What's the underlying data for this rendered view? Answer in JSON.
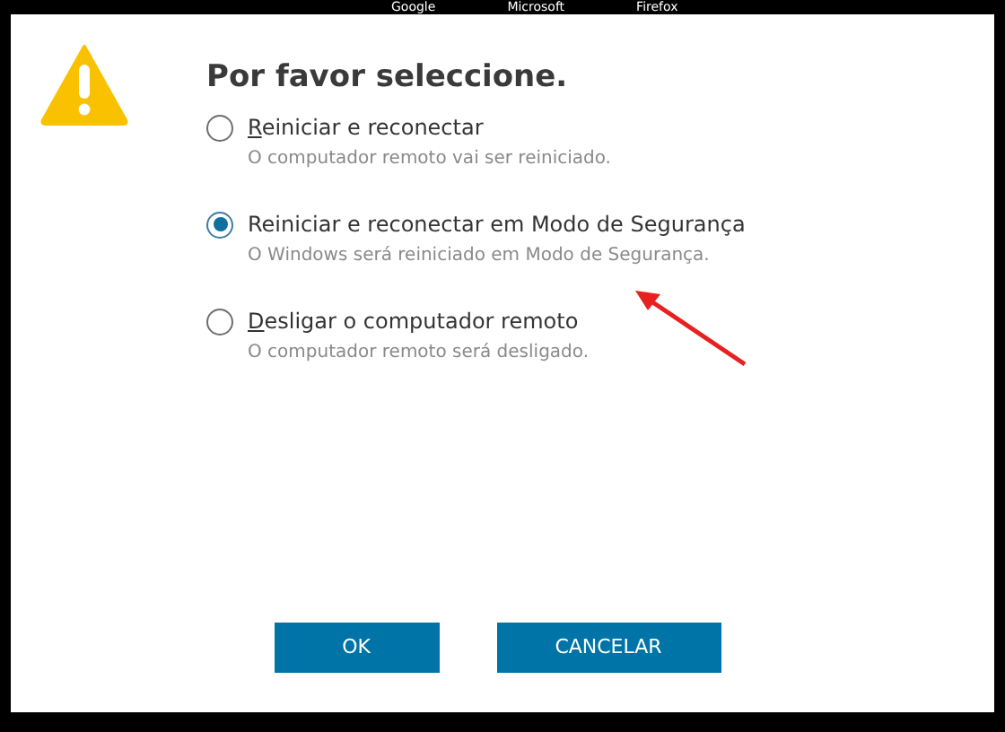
{
  "background_tabs": [
    "Google",
    "Microsoft",
    "Firefox"
  ],
  "dialog": {
    "title": "Por favor seleccione.",
    "options": [
      {
        "label": "Reiniciar e reconectar",
        "mnemonic": true,
        "description": "O computador remoto vai ser reiniciado.",
        "selected": false
      },
      {
        "label": "Reiniciar e reconectar em Modo de Segurança",
        "mnemonic": false,
        "description": "O Windows será reiniciado em Modo de Segurança.",
        "selected": true
      },
      {
        "label": "Desligar o computador remoto",
        "mnemonic": true,
        "description": "O computador remoto será desligado.",
        "selected": false
      }
    ],
    "buttons": [
      "OK",
      "CANCELAR"
    ]
  }
}
